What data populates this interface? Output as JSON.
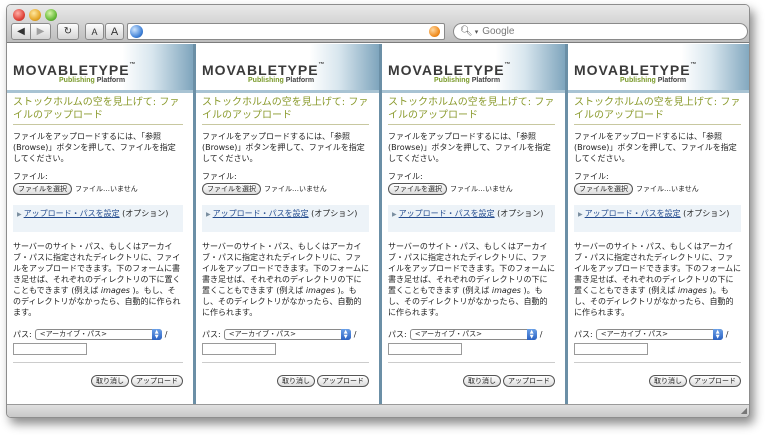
{
  "browser": {
    "search_placeholder": "Google",
    "font_small_label": "A",
    "font_large_label": "A"
  },
  "brand": {
    "logo_text": "MOVABLETYPE",
    "logo_tm": "™",
    "sub_green": "Publishing",
    "sub_rest": " Platform"
  },
  "upload": {
    "title": "ストックホルムの空を見上げて: ファイルのアップロード",
    "intro": "ファイルをアップロードするには、「参照(Browse)」ボタンを押して、ファイルを指定してください。",
    "file_label": "ファイル:",
    "choose_button": "ファイルを選択",
    "no_file": "ファイル…いません",
    "option_link": "アップロード・パスを設定",
    "option_suffix": " (オプション)",
    "description_before": "サーバーのサイト・パス、もしくはアーカイブ・パスに指定されたディレクトリに、ファイルをアップロードできます。下のフォームに書き足せば、それぞれのディレクトリの下に置くこともできます (例えば ",
    "description_italic": "images",
    "description_after": " )。もし、そのディレクトリがなかったら、自動的に作られます。",
    "path_label": "パス:",
    "path_option": "<アーカイブ・パス>",
    "path_slash": "/",
    "cancel_button": "取り消し",
    "upload_button": "アップロード"
  },
  "colors": {
    "title_green": "#8a9a2c",
    "link_blue": "#234b8e",
    "header_blue": "#7fa5bd"
  }
}
